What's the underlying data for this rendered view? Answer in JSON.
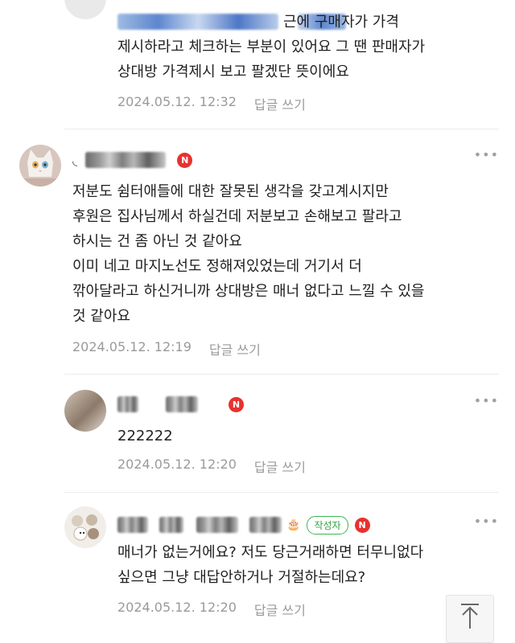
{
  "comments": [
    {
      "author": "",
      "badge": "",
      "text_lines": [
        "근에 구매자가 가격",
        "제시하라고 체크하는 부분이 있어요 그 땐 판매자가",
        "상대방 가격제시 보고 팔겠단 뜻이에요"
      ],
      "date": "2024.05.12. 12:32",
      "reply_label": "답글 쓰기"
    },
    {
      "author": "",
      "badge": "N",
      "text_lines": [
        "저분도 쉼터애들에 대한 잘못된 생각을 갖고계시지만",
        "후원은 집사님께서 하실건데 저분보고 손해보고 팔라고",
        "하시는 건 좀 아닌 것 같아요",
        "이미 네고 마지노선도 정해져있었는데 거기서 더",
        "깎아달라고 하신거니까 상대방은 매너 없다고 느낄 수 있을",
        "것 같아요"
      ],
      "date": "2024.05.12. 12:19",
      "reply_label": "답글 쓰기"
    },
    {
      "author": "",
      "badge": "N",
      "text_lines": [
        "222222"
      ],
      "date": "2024.05.12. 12:20",
      "reply_label": "답글 쓰기"
    },
    {
      "author": "",
      "writer_badge": "작성자",
      "badge": "N",
      "text_lines": [
        "매너가 없는거에요? 저도 당근거래하면 터무니없다",
        "싶으면 그냥 대답안하거나 거절하는데요?"
      ],
      "date": "2024.05.12. 12:20",
      "reply_label": "답글 쓰기"
    }
  ],
  "more_icon": "more-dots-icon",
  "scroll_top_icon": "arrow-up-icon",
  "colors": {
    "new_badge": "#e8312f",
    "writer_badge": "#3fb550",
    "meta_text": "#9a9a9a"
  }
}
